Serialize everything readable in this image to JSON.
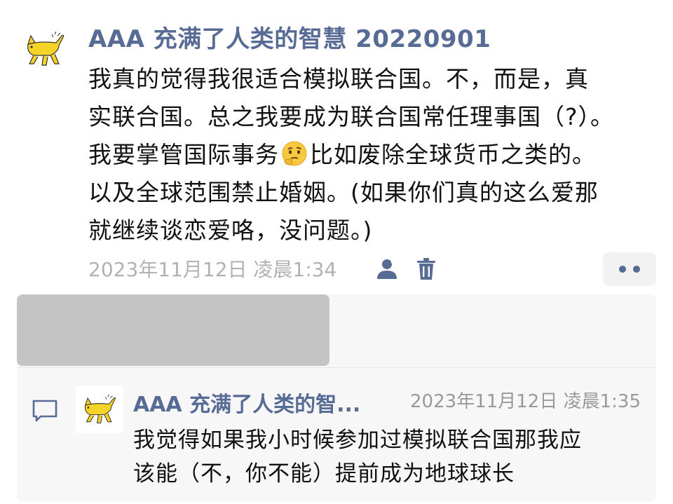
{
  "post": {
    "author": "AAA 充满了人类的智慧 20220901",
    "avatar_icon": "yellow-cat-icon",
    "text_lines": [
      "我真的觉得我很适合模拟联合国。不，而是，真",
      "实联合国。总之我要成为联合国常任理事国（?）。",
      "我要掌管国际事务",
      "比如废除全球货币之类的。",
      "以及全球范围禁止婚姻。(如果你们真的这么爱那",
      "就继续谈恋爱咯，没问题。)"
    ],
    "emoji": "thinking-face-emoji",
    "timestamp": "2023年11月12日 凌晨1:34"
  },
  "actions": {
    "privacy_icon": "person-icon",
    "delete_icon": "trash-icon",
    "more_icon": "more-dots-icon"
  },
  "comment": {
    "author": "AAA 充满了人类的智...",
    "timestamp": "2023年11月12日 凌晨1:35",
    "text_lines": [
      "我觉得如果我小时候参加过模拟联合国那我应",
      "该能（不，你不能）提前成为地球球长"
    ]
  },
  "colors": {
    "link": "#576b95",
    "timestamp": "#b2b2b2",
    "comment_bg": "#f7f7f7",
    "redacted": "#c4c4c4",
    "cat": "#f5d327"
  }
}
